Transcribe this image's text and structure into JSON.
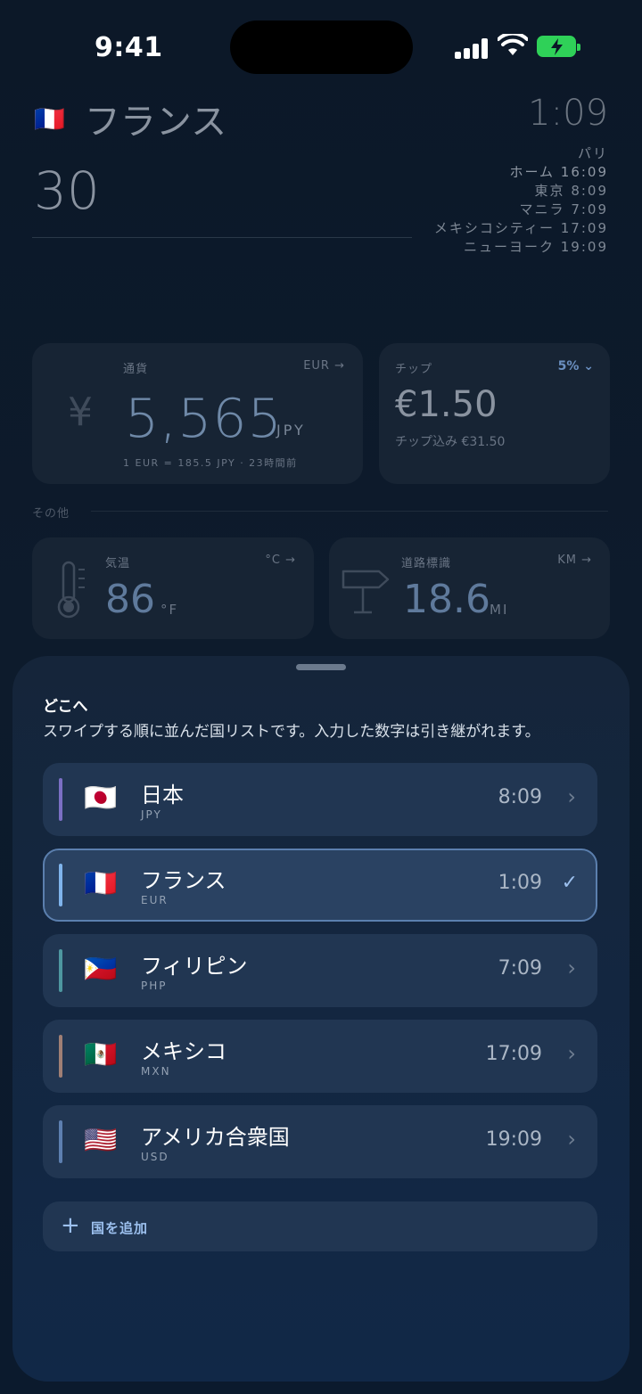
{
  "status_bar": {
    "time": "9:41"
  },
  "header": {
    "flag": "🇫🇷",
    "country": "フランス",
    "local_time": "1:09",
    "amount": "30",
    "cities": [
      {
        "label": "パリ"
      },
      {
        "label": "ホーム 16:09"
      },
      {
        "label": "東京 8:09"
      },
      {
        "label": "マニラ 7:09"
      },
      {
        "label": "メキシコシティー 17:09"
      },
      {
        "label": "ニューヨーク 19:09"
      }
    ]
  },
  "currency_card": {
    "label": "通貨",
    "target": "EUR →",
    "symbol": "¥",
    "value": "5,565",
    "unit": "JPY",
    "rate": "1 EUR = 185.5 JPY · 23時間前"
  },
  "tip_card": {
    "label": "チップ",
    "percent": "5% ⌄",
    "value": "€1.50",
    "subtitle": "チップ込み €31.50"
  },
  "section_other": "その他",
  "temperature_card": {
    "label": "気温",
    "target": "°C →",
    "value": "86",
    "unit": "°F"
  },
  "road_sign_card": {
    "label": "道路標識",
    "target": "KM →",
    "value": "18.6",
    "unit": "MI"
  },
  "sheet": {
    "title": "どこへ",
    "description": "スワイプする順に並んだ国リストです。入力した数字は引き継がれます。",
    "countries": [
      {
        "flag": "🇯🇵",
        "name": "日本",
        "code": "JPY",
        "time": "8:09",
        "accent": "#7b6fc4",
        "selected": false
      },
      {
        "flag": "🇫🇷",
        "name": "フランス",
        "code": "EUR",
        "time": "1:09",
        "accent": "#7fb4ec",
        "selected": true
      },
      {
        "flag": "🇵🇭",
        "name": "フィリピン",
        "code": "PHP",
        "time": "7:09",
        "accent": "#4e97a0",
        "selected": false
      },
      {
        "flag": "🇲🇽",
        "name": "メキシコ",
        "code": "MXN",
        "time": "17:09",
        "accent": "#a07f75",
        "selected": false
      },
      {
        "flag": "🇺🇸",
        "name": "アメリカ合衆国",
        "code": "USD",
        "time": "19:09",
        "accent": "#5d7fb0",
        "selected": false
      }
    ],
    "add_label": "国を追加"
  },
  "icons": {
    "chevron": "chevron-right-icon",
    "check": "checkmark-icon",
    "plus": "plus-icon"
  }
}
